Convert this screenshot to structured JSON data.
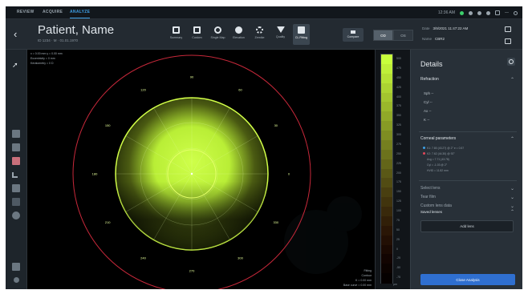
{
  "topbar": {
    "tabs": [
      "REVIEW",
      "ACQUIRE",
      "ANALYZE"
    ],
    "time": "12:36 AM"
  },
  "header": {
    "patient_name": "Patient, Name",
    "patient_info": "ID 1234 · M · 01.01.1970",
    "tools": [
      {
        "label": "Summary",
        "icon": "grid-icon"
      },
      {
        "label": "Custom",
        "icon": "custom-layout-icon"
      },
      {
        "label": "Single Map",
        "icon": "single-map-icon"
      },
      {
        "label": "Elevation",
        "icon": "elevation-icon"
      },
      {
        "label": "Zernike",
        "icon": "zernike-icon"
      },
      {
        "label": "Quality",
        "icon": "quality-icon"
      },
      {
        "label": "CL Fitting",
        "icon": "cl-fitting-icon"
      }
    ],
    "active_tool": "CL Fitting",
    "compare_label": "Compare",
    "eye_toggle": [
      "OD",
      "OS"
    ],
    "eye_selected": "OD",
    "date_label": "Date",
    "date_value": "3/9/2021 11:47:22 AM",
    "name_label": "Name",
    "name_value": "CBR2"
  },
  "viewport": {
    "info_lines": [
      "x = 0.00 mm  y = 0.00 mm",
      "Eccentricity = 0 mm",
      "Keratometry = 0 D"
    ],
    "footer_lines": [
      "Fitting",
      "Contour",
      "K = 0.00 mm",
      "Base curve = 0.00 mm"
    ],
    "axis_ticks": [
      "0",
      "30",
      "60",
      "90",
      "120",
      "150",
      "180",
      "210",
      "240",
      "270",
      "300",
      "330"
    ]
  },
  "scale": {
    "unit": "µm",
    "ticks": [
      "500",
      "475",
      "450",
      "425",
      "400",
      "375",
      "350",
      "325",
      "300",
      "275",
      "250",
      "225",
      "200",
      "175",
      "150",
      "125",
      "100",
      "75",
      "50",
      "25",
      "0",
      "-25",
      "-50",
      "-75"
    ],
    "colors": [
      "#c8ff3c",
      "#bff039",
      "#b6e235",
      "#acd332",
      "#a3c52f",
      "#9ab72b",
      "#90a928",
      "#879b25",
      "#7e8d22",
      "#757f1f",
      "#6c721c",
      "#636519",
      "#5a5816",
      "#524c13",
      "#493f10",
      "#41340d",
      "#39290b",
      "#311f08",
      "#2a1606",
      "#220f04",
      "#1a0902",
      "#120401",
      "#0b0200",
      "#050000"
    ]
  },
  "details": {
    "title": "Details",
    "refraction_label": "Refraction",
    "refraction": [
      {
        "key": "Sph",
        "value": "--"
      },
      {
        "key": "Cyl",
        "value": "--"
      },
      {
        "key": "Ax",
        "value": "--"
      },
      {
        "key": "K",
        "value": "--"
      }
    ],
    "corneal_label": "Corneal parameters",
    "corneal_params": [
      "K1: 7.80 (43.27) @ 2°    e = 0.57",
      "K2: 7.62 (44.30) @ 92°",
      "Avg = 7.71 (43.78)",
      "Cyl = -1.03 @ 2°",
      "HVID = 11.82 mm"
    ],
    "collapsed_sections": [
      "Select lens",
      "Tear film",
      "Custom lens data"
    ],
    "saved_lenses_label": "Saved lenses",
    "add_lens_label": "Add lens",
    "close_label": "Close Analysis"
  },
  "colors": {
    "accent": "#3ea0e6",
    "close_button": "#2f6fd0",
    "map_green": "#c8ff3c",
    "reference_circle": "#c7283a"
  }
}
